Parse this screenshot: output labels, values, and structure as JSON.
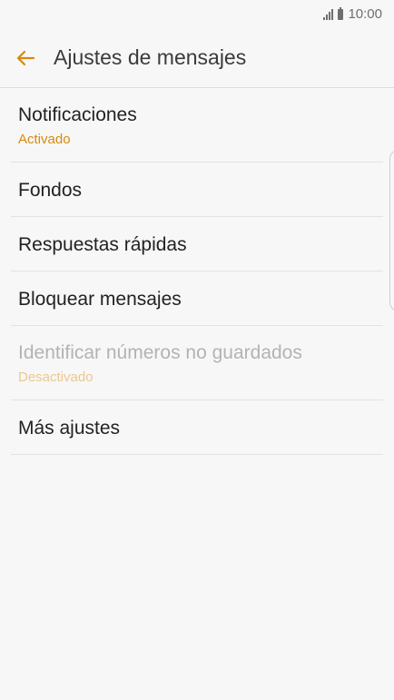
{
  "status_bar": {
    "time": "10:00"
  },
  "header": {
    "title": "Ajustes de mensajes",
    "back_icon": "arrow-left-icon",
    "accent_color": "#d58a0e"
  },
  "settings": {
    "items": [
      {
        "title": "Notificaciones",
        "subtitle": "Activado"
      },
      {
        "title": "Fondos"
      },
      {
        "title": "Respuestas rápidas"
      },
      {
        "title": "Bloquear mensajes"
      },
      {
        "title": "Identificar números no guardados",
        "subtitle": "Desactivado"
      },
      {
        "title": "Más ajustes"
      }
    ]
  }
}
